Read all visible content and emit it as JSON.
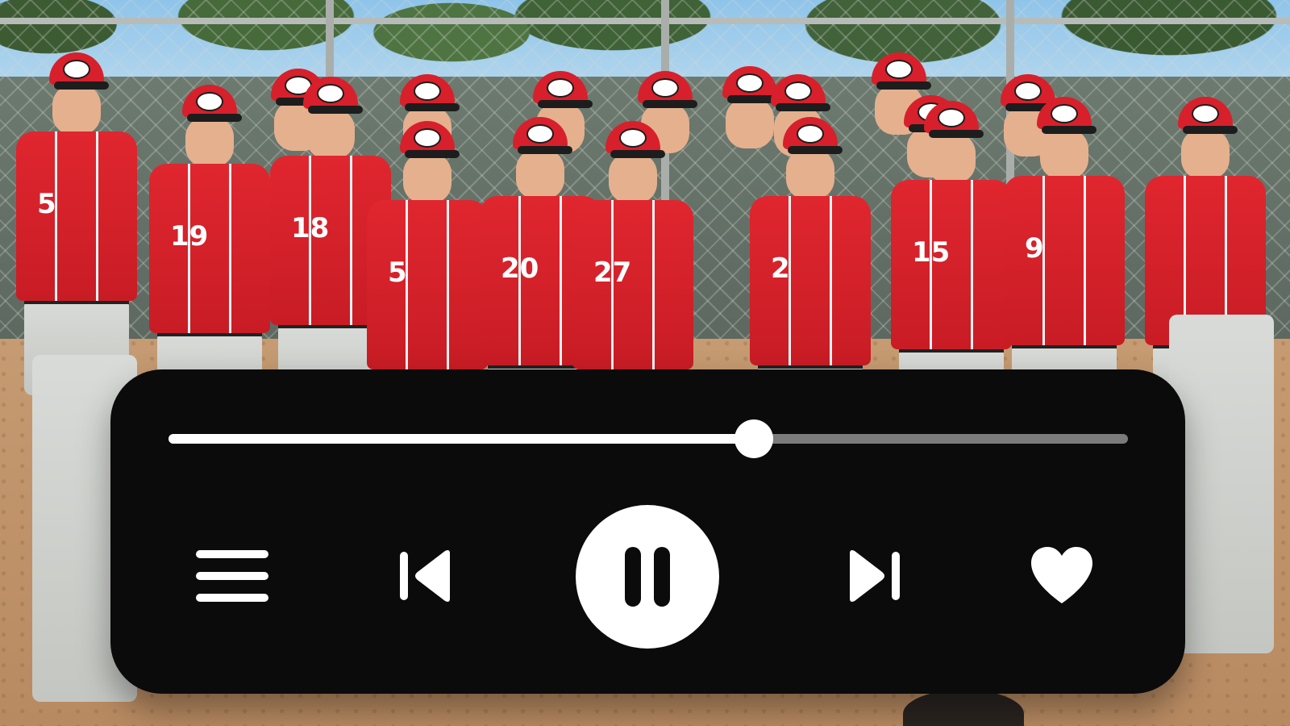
{
  "background_photo": {
    "subject": "baseball team photo",
    "jersey_color": "#d7202b",
    "jersey_numbers": [
      "5",
      "19",
      "18",
      "5",
      "20",
      "27",
      "2",
      "15",
      "9"
    ]
  },
  "media_player": {
    "playback_progress_fraction": 0.61,
    "state": "playing",
    "colors": {
      "panel": "#0b0b0b",
      "track_remaining": "#7b7b7b",
      "track_played": "#ffffff",
      "icons": "#ffffff"
    },
    "controls": {
      "queue_icon": "menu-lines",
      "previous_icon": "skip-previous",
      "play_pause_icon": "pause",
      "next_icon": "skip-next",
      "like_icon": "heart"
    }
  }
}
